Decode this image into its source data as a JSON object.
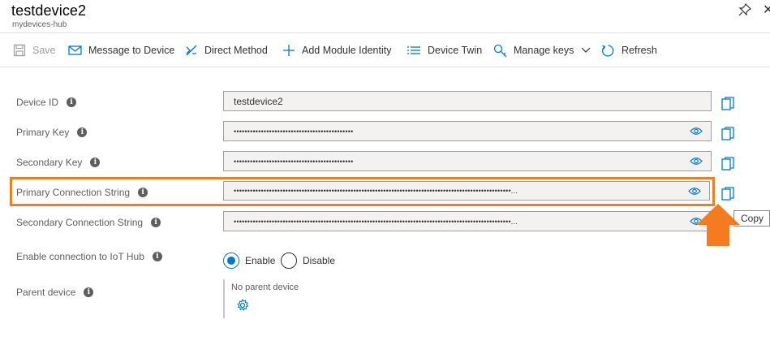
{
  "header": {
    "title": "testdevice2",
    "subtitle": "mydevices-hub"
  },
  "toolbar": {
    "save": "Save",
    "message": "Message to Device",
    "direct_method": "Direct Method",
    "add_module": "Add Module Identity",
    "device_twin": "Device Twin",
    "manage_keys": "Manage keys",
    "refresh": "Refresh"
  },
  "fields": {
    "device_id": {
      "label": "Device ID",
      "value": "testdevice2"
    },
    "primary_key": {
      "label": "Primary Key",
      "value": "••••••••••••••••••••••••••••••••••••••••••••"
    },
    "secondary_key": {
      "label": "Secondary Key",
      "value": "••••••••••••••••••••••••••••••••••••••••••••"
    },
    "primary_conn": {
      "label": "Primary Connection String",
      "value": "••••••••••••••••••••••••••••••••••••••••••••••••••••••••••••••••••••••••••••••••••••••••••••••••••••••..."
    },
    "secondary_conn": {
      "label": "Secondary Connection String",
      "value": "••••••••••••••••••••••••••••••••••••••••••••••••••••••••••••••••••••••••••••••••••••••••••••••••••••••..."
    }
  },
  "iot_hub": {
    "label": "Enable connection to IoT Hub",
    "enable": "Enable",
    "disable": "Disable",
    "selected": "Enable"
  },
  "parent": {
    "label": "Parent device",
    "value": "No parent device"
  },
  "tooltip": {
    "text": "Copy"
  },
  "colors": {
    "accent": "#0078d4",
    "highlight": "#f47b20",
    "arrow": "#f47b20"
  }
}
